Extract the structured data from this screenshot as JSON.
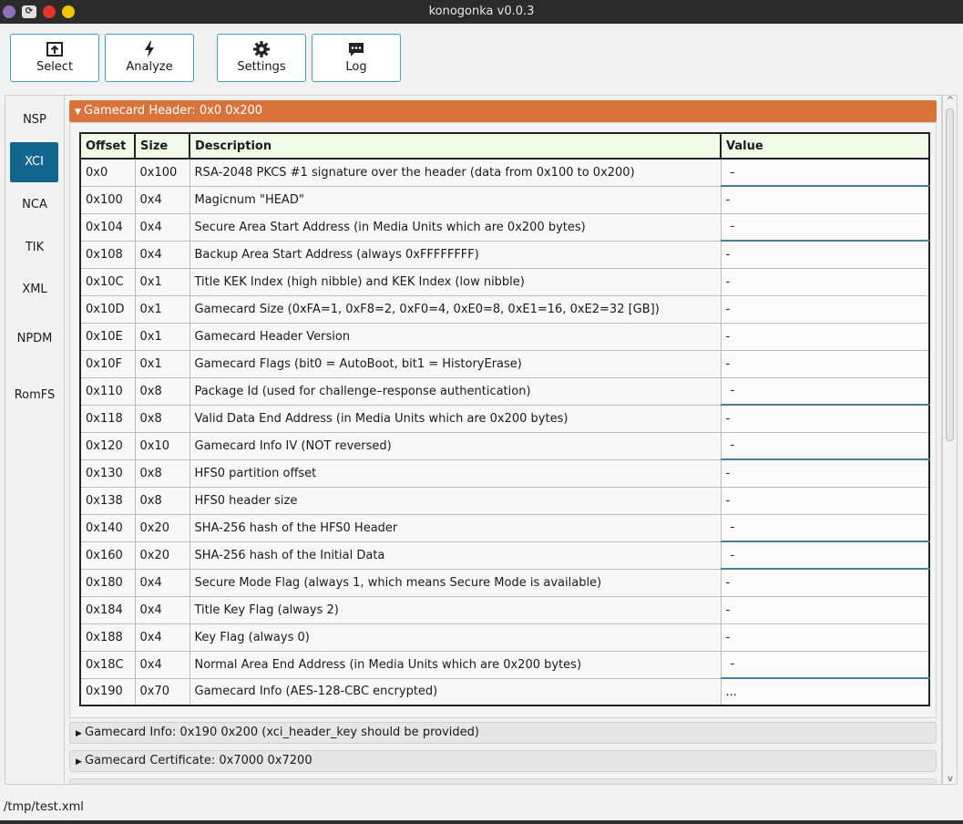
{
  "window": {
    "title": "konogonka v0.0.3"
  },
  "toolbar": {
    "select_label": "Select",
    "analyze_label": "Analyze",
    "settings_label": "Settings",
    "log_label": "Log"
  },
  "sidenav": {
    "items": [
      {
        "label": "NSP",
        "active": false
      },
      {
        "label": "XCI",
        "active": true
      },
      {
        "label": "NCA",
        "active": false
      },
      {
        "label": "TIK",
        "active": false
      },
      {
        "label": "XML",
        "active": false
      },
      {
        "label": "NPDM",
        "active": false
      },
      {
        "label": "RomFS",
        "active": false
      }
    ]
  },
  "sections": {
    "open_title": "Gamecard Header: 0x0 0x200",
    "closed": [
      "Gamecard Info: 0x190 0x200 (xci_header_key should be provided)",
      "Gamecard Certificate: 0x7000 0x7200"
    ]
  },
  "table": {
    "headers": [
      "Offset",
      "Size",
      "Description",
      "Value"
    ],
    "rows": [
      [
        "0x0",
        "0x100",
        "RSA-2048 PKCS #1 signature over the header (data from 0x100 to 0x200)",
        "-"
      ],
      [
        "0x100",
        "0x4",
        "Magicnum \"HEAD\"",
        "-"
      ],
      [
        "0x104",
        "0x4",
        "Secure Area Start Address (in Media Units which are 0x200 bytes)",
        "-"
      ],
      [
        "0x108",
        "0x4",
        "Backup Area Start Address (always 0xFFFFFFFF)",
        "-"
      ],
      [
        "0x10C",
        "0x1",
        "Title KEK Index (high nibble) and KEK Index (low nibble)",
        "-"
      ],
      [
        "0x10D",
        "0x1",
        "Gamecard Size (0xFA=1, 0xF8=2, 0xF0=4, 0xE0=8, 0xE1=16, 0xE2=32 [GB])",
        "-"
      ],
      [
        "0x10E",
        "0x1",
        "Gamecard Header Version",
        "-"
      ],
      [
        "0x10F",
        "0x1",
        "Gamecard Flags (bit0 = AutoBoot, bit1 = HistoryErase)",
        "-"
      ],
      [
        "0x110",
        "0x8",
        "Package Id (used for challenge–response authentication)",
        "-"
      ],
      [
        "0x118",
        "0x8",
        "Valid Data End Address (in Media Units which are 0x200 bytes)",
        "-"
      ],
      [
        "0x120",
        "0x10",
        "Gamecard Info IV (NOT reversed)",
        "-"
      ],
      [
        "0x130",
        "0x8",
        "HFS0 partition offset",
        "-"
      ],
      [
        "0x138",
        "0x8",
        "HFS0 header size",
        "-"
      ],
      [
        "0x140",
        "0x20",
        "SHA-256 hash of the HFS0 Header",
        "-"
      ],
      [
        "0x160",
        "0x20",
        "SHA-256 hash of the Initial Data",
        "-"
      ],
      [
        "0x180",
        "0x4",
        "Secure Mode Flag (always 1, which means Secure Mode is available)",
        "-"
      ],
      [
        "0x184",
        "0x4",
        "Title Key Flag (always 2)",
        "-"
      ],
      [
        "0x188",
        "0x4",
        "Key Flag (always 0)",
        "-"
      ],
      [
        "0x18C",
        "0x4",
        "Normal Area End Address (in Media Units which are 0x200 bytes)",
        "-"
      ],
      [
        "0x190",
        "0x70",
        "Gamecard Info (AES-128-CBC encrypted)",
        "..."
      ]
    ]
  },
  "status": {
    "path": "/tmp/test.xml"
  }
}
